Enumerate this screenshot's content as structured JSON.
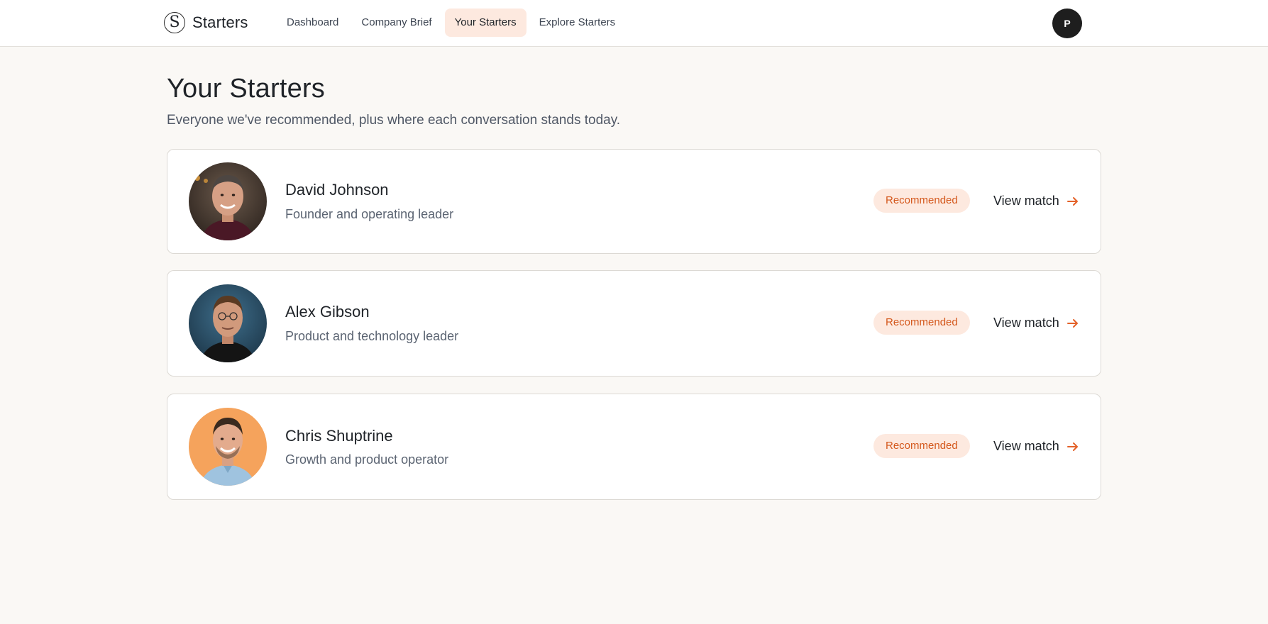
{
  "brand": {
    "logo_letter": "S",
    "name": "Starters"
  },
  "nav": {
    "items": [
      {
        "label": "Dashboard",
        "active": false
      },
      {
        "label": "Company Brief",
        "active": false
      },
      {
        "label": "Your Starters",
        "active": true
      },
      {
        "label": "Explore Starters",
        "active": false
      }
    ]
  },
  "user": {
    "initial": "P"
  },
  "page": {
    "title": "Your Starters",
    "subtitle": "Everyone we've recommended, plus where each conversation stands today."
  },
  "starters": [
    {
      "name": "David Johnson",
      "role": "Founder and operating leader",
      "status": "Recommended",
      "action": "View match",
      "avatar_icon": "person-photo-icon"
    },
    {
      "name": "Alex Gibson",
      "role": "Product and technology leader",
      "status": "Recommended",
      "action": "View match",
      "avatar_icon": "person-photo-icon"
    },
    {
      "name": "Chris Shuptrine",
      "role": "Growth and product operator",
      "status": "Recommended",
      "action": "View match",
      "avatar_icon": "person-photo-icon"
    }
  ],
  "colors": {
    "accent": "#e4622a",
    "badge_bg": "#fde9df",
    "badge_text": "#d4581c",
    "nav_active_bg": "#fde9df",
    "page_bg": "#faf8f5"
  }
}
